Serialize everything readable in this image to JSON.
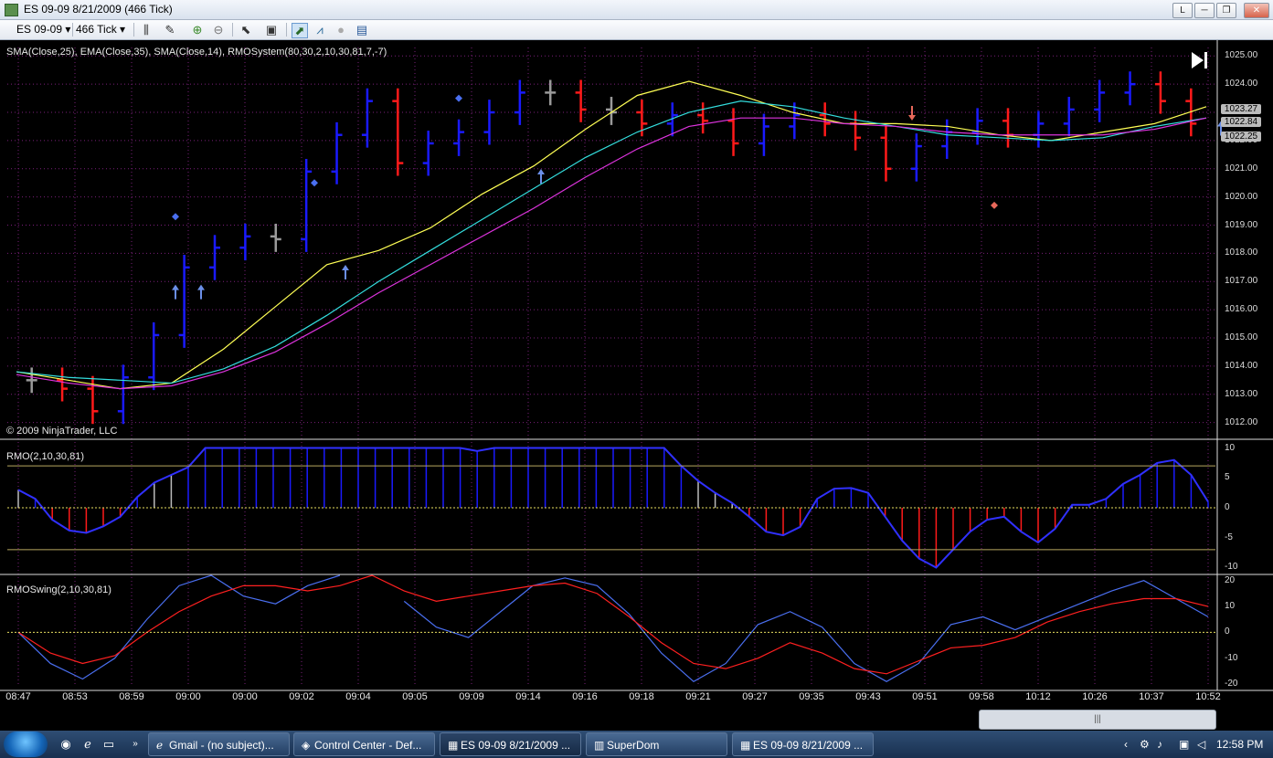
{
  "window": {
    "title": "ES 09-09  8/21/2009 (466 Tick)",
    "buttons": [
      "L",
      "─",
      "❐",
      "✕"
    ]
  },
  "toolbar": {
    "instrument": "ES 09-09",
    "period": "466 Tick",
    "icons": [
      "bar-type-icon",
      "draw-tool-icon",
      "zoom-in-icon",
      "zoom-out-icon",
      "pointer-icon",
      "properties-icon",
      "strategy-icon",
      "indicator-icon",
      "globe-icon",
      "data-box-icon"
    ]
  },
  "colors": {
    "up": "#1a1aff",
    "down": "#ff1a1a",
    "neutral": "#9a9a9a",
    "sma25": "#ffff55",
    "ema35": "#33dddd",
    "sma14": "#dd33dd",
    "grid": "#7a1f7a",
    "swing_fast": "#4a6ff0",
    "swing_slow": "#ff2020",
    "zero": "#e8e060"
  },
  "chart_data": [
    {
      "type": "bar",
      "title": "SMA(Close,25), EMA(Close,35), SMA(Close,14), RMOSystem(80,30,2,10,30,81,7,-7)",
      "copyright": "© 2009 NinjaTrader, LLC",
      "style": "OHLC tick bars",
      "ylim": [
        1011.6,
        1025.3
      ],
      "yticks": [
        "1025.00",
        "1024.00",
        "1023.00",
        "1022.00",
        "1021.00",
        "1020.00",
        "1019.00",
        "1018.00",
        "1017.00",
        "1016.00",
        "1015.00",
        "1014.00",
        "1013.00",
        "1012.00"
      ],
      "x": [
        "08:47",
        "08:53",
        "08:59",
        "09:00",
        "09:00",
        "09:02",
        "09:04",
        "09:05",
        "09:09",
        "09:14",
        "09:16",
        "09:18",
        "09:21",
        "09:27",
        "09:35",
        "09:43",
        "09:51",
        "09:58",
        "10:12",
        "10:26",
        "10:37",
        "10:52"
      ],
      "close": [
        1013.5,
        1013.2,
        1012.4,
        1013.6,
        1015.1,
        1017.5,
        1018.2,
        1018.6,
        1018.5,
        1020.9,
        1022.2,
        1023.4,
        1021.2,
        1021.9,
        1022.3,
        1023.0,
        1023.7,
        1023.7,
        1023.1,
        1023.0,
        1022.6,
        1022.9,
        1022.7,
        1021.9,
        1022.5,
        1022.9,
        1022.6,
        1022.1,
        1021.0,
        1021.8,
        1022.3,
        1022.7,
        1022.2,
        1022.6,
        1023.1,
        1023.7,
        1024.0,
        1023.4,
        1022.6
      ],
      "series": [
        {
          "name": "SMA(Close,25)",
          "values": [
            1013.8,
            1013.5,
            1013.2,
            1013.4,
            1014.6,
            1016.1,
            1017.6,
            1018.1,
            1018.9,
            1020.1,
            1021.1,
            1022.4,
            1023.6,
            1024.1,
            1023.6,
            1023.0,
            1022.6,
            1022.6,
            1022.5,
            1022.2,
            1022.0,
            1022.3,
            1022.6,
            1023.2
          ]
        },
        {
          "name": "EMA(Close,35)",
          "values": [
            1013.8,
            1013.6,
            1013.5,
            1013.4,
            1013.9,
            1014.7,
            1015.8,
            1017.0,
            1018.1,
            1019.2,
            1020.3,
            1021.4,
            1022.3,
            1023.0,
            1023.4,
            1023.2,
            1022.8,
            1022.5,
            1022.2,
            1022.1,
            1022.0,
            1022.1,
            1022.5,
            1022.8
          ]
        },
        {
          "name": "SMA(Close,14)",
          "values": [
            1013.7,
            1013.4,
            1013.2,
            1013.3,
            1013.8,
            1014.5,
            1015.5,
            1016.6,
            1017.6,
            1018.6,
            1019.6,
            1020.7,
            1021.7,
            1022.5,
            1022.8,
            1022.8,
            1022.6,
            1022.5,
            1022.3,
            1022.2,
            1022.2,
            1022.2,
            1022.4,
            1022.8
          ]
        }
      ],
      "markers": [
        {
          "type": "up-arrow",
          "x": "09:00",
          "price": 1016.6
        },
        {
          "type": "up-arrow",
          "x": "09:00",
          "price": 1016.6
        },
        {
          "type": "up-arrow",
          "x": "09:04",
          "price": 1017.3
        },
        {
          "type": "up-arrow",
          "x": "09:14",
          "price": 1020.7
        },
        {
          "type": "down-arrow",
          "x": "09:51",
          "price": 1023.0
        },
        {
          "type": "up-arrow",
          "x": "10:52",
          "price": 1022.4
        },
        {
          "type": "diamond",
          "x": "09:00",
          "price": 1019.3
        },
        {
          "type": "diamond",
          "x": "09:02",
          "price": 1020.5
        },
        {
          "type": "diamond",
          "x": "09:09",
          "price": 1023.5
        },
        {
          "type": "diamond-red",
          "x": "09:58",
          "price": 1019.7
        }
      ],
      "last_values": [
        "1023.27",
        "1022.84",
        "1022.25"
      ]
    },
    {
      "type": "bar",
      "title": "RMO(2,10,30,81)",
      "ylim": [
        -11,
        11
      ],
      "yticks": [
        "10",
        "5",
        "0",
        "-5",
        "-10"
      ],
      "levels": [
        7,
        -7
      ],
      "values": [
        3,
        1.5,
        -2,
        -3.8,
        -4.2,
        -3.1,
        -1.5,
        1.8,
        4.2,
        5.5,
        6.8,
        10,
        10,
        10,
        10,
        10,
        10,
        10,
        10,
        10,
        10,
        10,
        10,
        10,
        10,
        10,
        10,
        9.5,
        10,
        10,
        10,
        10,
        10,
        10,
        10,
        10,
        10,
        10,
        10,
        7,
        4.5,
        2.5,
        0.8,
        -1.5,
        -4,
        -4.6,
        -3.2,
        1.5,
        3.2,
        3.3,
        2.5,
        -1.5,
        -5.5,
        -8.5,
        -10,
        -7,
        -4,
        -2,
        -1.5,
        -4,
        -5.8,
        -3.5,
        0.5,
        0.5,
        1.5,
        4,
        5.5,
        7.5,
        8,
        5.5,
        1
      ]
    },
    {
      "type": "line",
      "title": "RMOSwing(2,10,30,81)",
      "ylim": [
        -21,
        22
      ],
      "yticks": [
        "20",
        "10",
        "0",
        "-10",
        "-20"
      ],
      "series": [
        {
          "name": "fast",
          "values": [
            0,
            -12,
            -18,
            -10,
            5,
            18,
            22,
            14,
            11,
            18,
            22,
            null,
            12,
            2,
            -2,
            8,
            18,
            21,
            18,
            7,
            -8,
            -19,
            -12,
            3,
            8,
            2,
            -12,
            -19,
            -12,
            3,
            6,
            1,
            6,
            11,
            16,
            20,
            13,
            6
          ]
        },
        {
          "name": "slow",
          "values": [
            0,
            -8,
            -12,
            -9,
            0,
            8,
            14,
            18,
            18,
            16,
            18,
            22,
            16,
            12,
            14,
            16,
            18,
            19,
            15,
            6,
            -4,
            -12,
            -14,
            -10,
            -4,
            -8,
            -14,
            -16,
            -11,
            -6,
            -5,
            -2,
            4,
            8,
            11,
            13,
            13,
            10
          ]
        }
      ]
    }
  ],
  "hscroll": "|||",
  "taskbar": {
    "buttons": [
      "Gmail - (no subject)...",
      "Control Center - Def...",
      "ES 09-09  8/21/2009 ...",
      "SuperDom",
      "ES 09-09  8/21/2009 ..."
    ],
    "clock": "12:58 PM"
  }
}
